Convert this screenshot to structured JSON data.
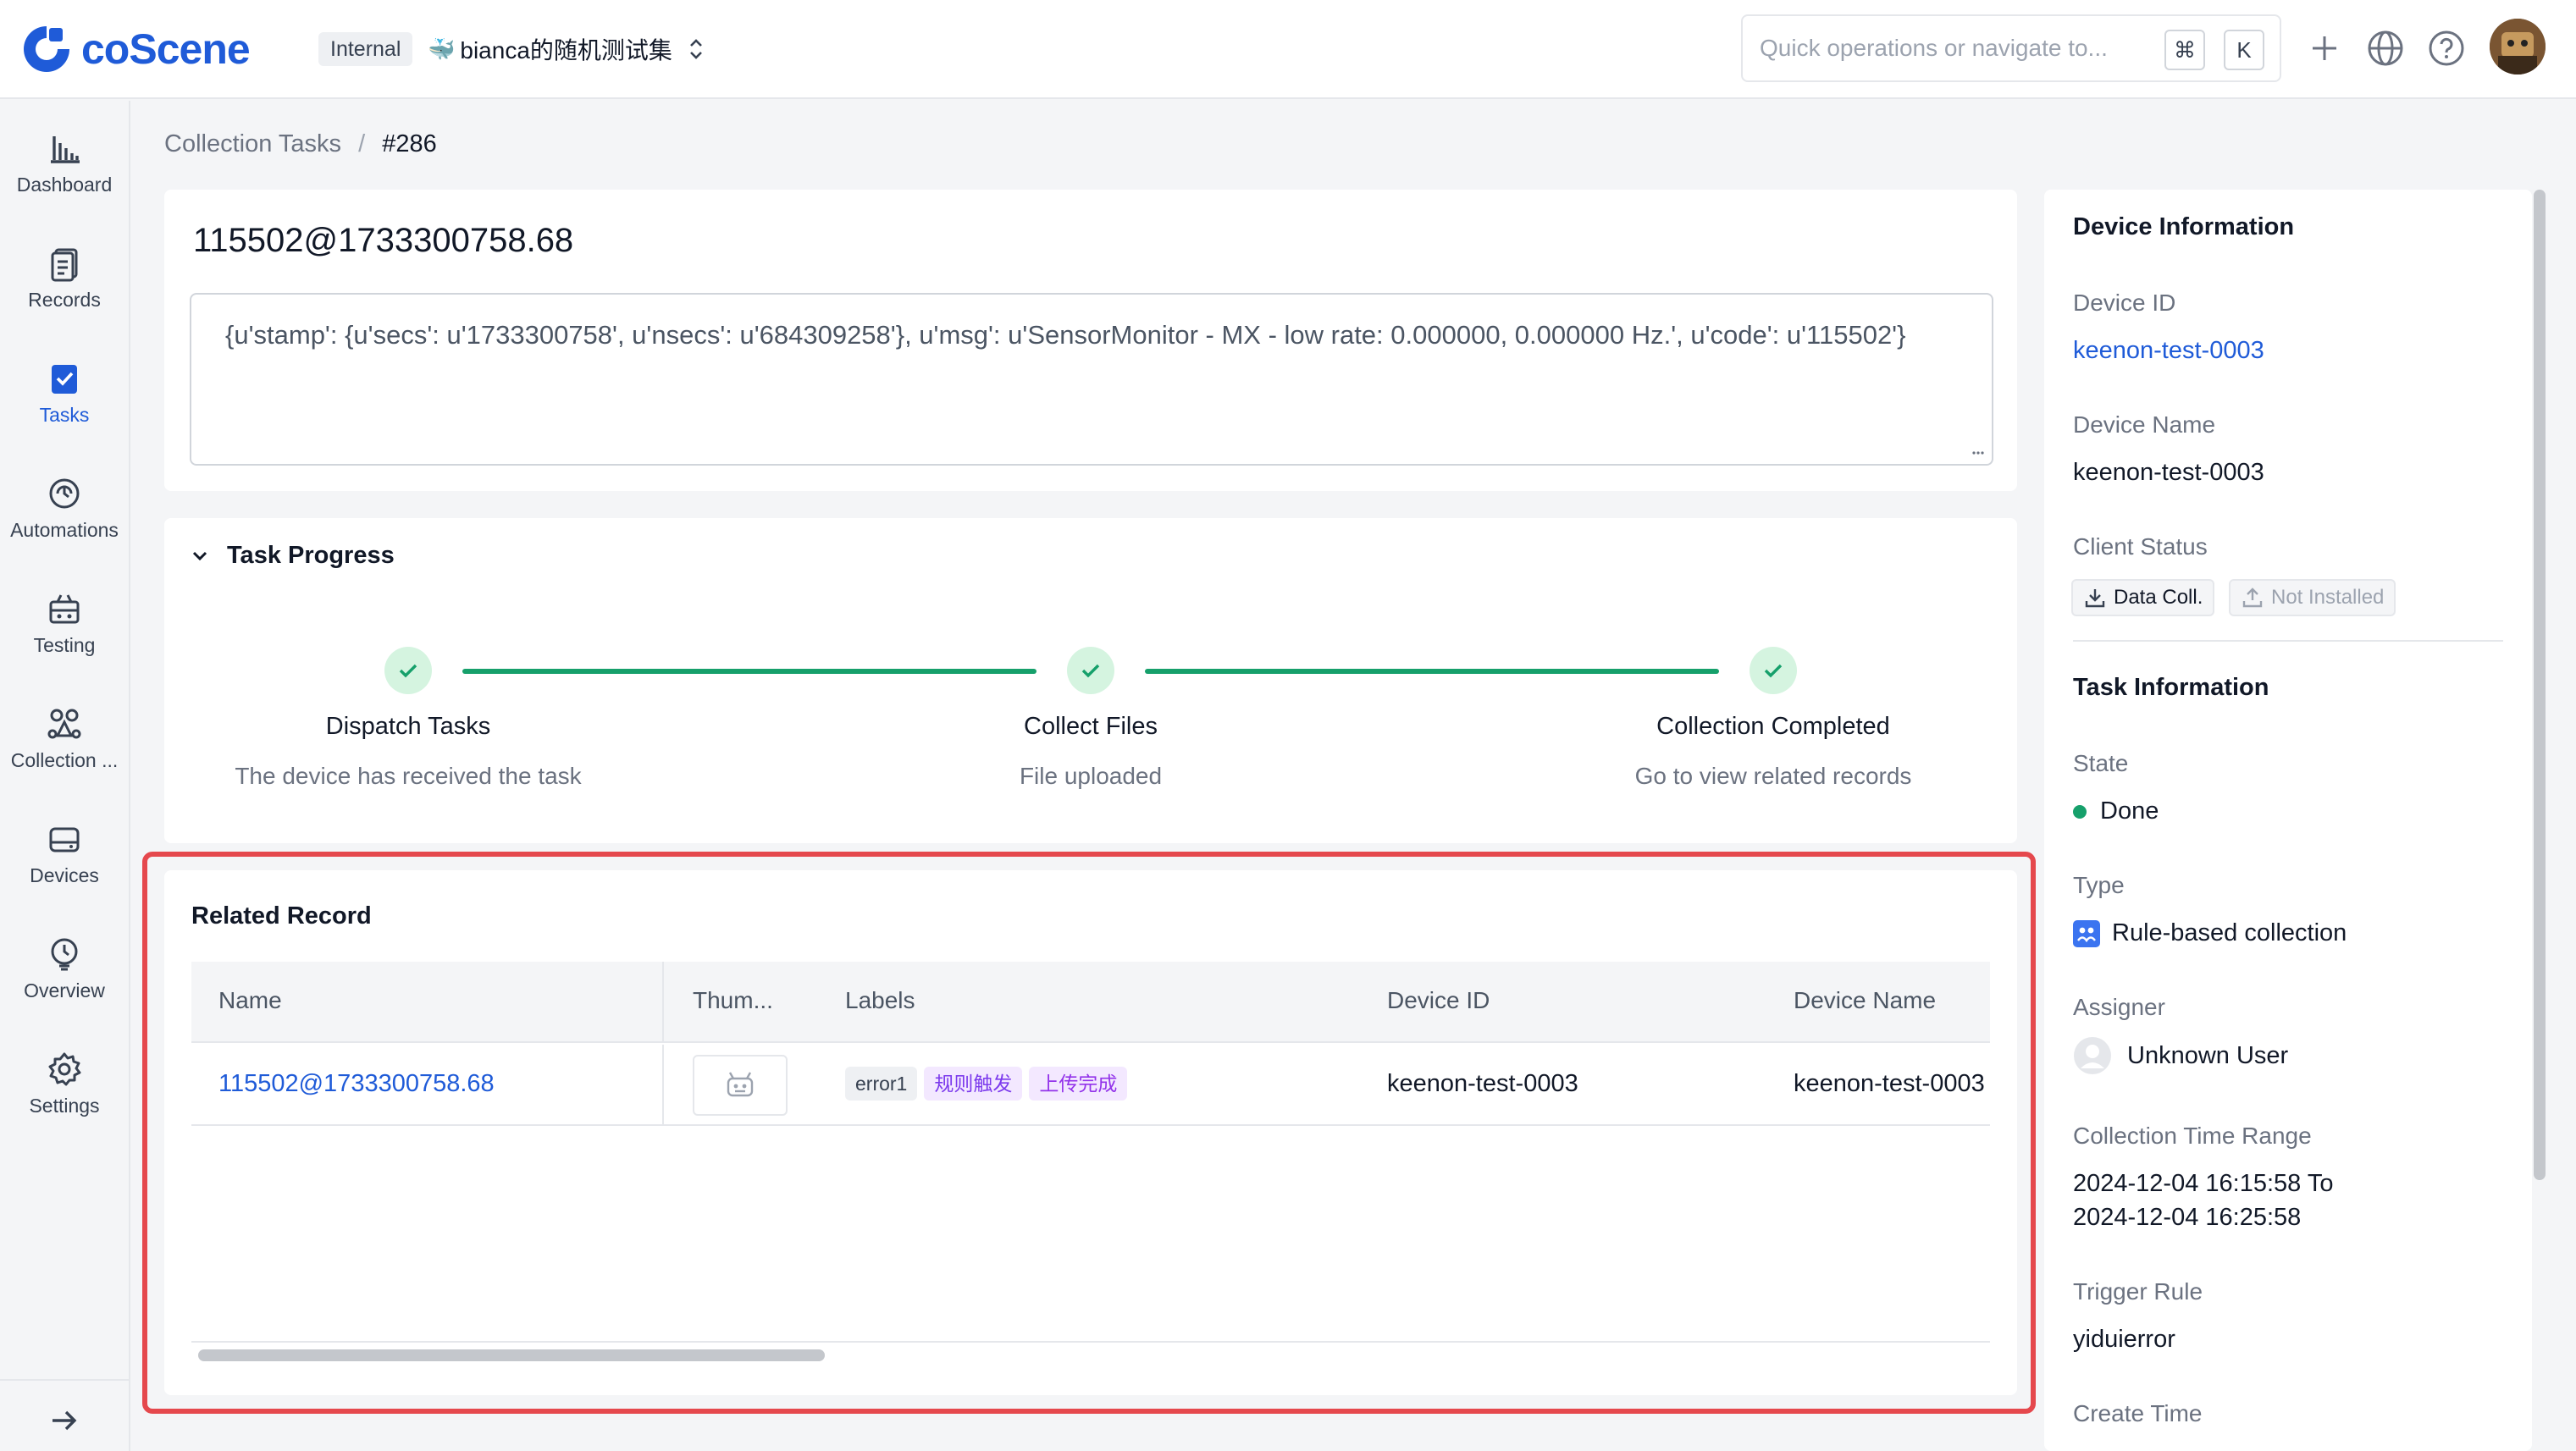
{
  "app": {
    "brand": "coScene",
    "badge": "Internal",
    "project": "bianca的随机测试集",
    "brand_color": "#1f5bd8"
  },
  "search": {
    "placeholder": "Quick operations or navigate to...",
    "key1": "⌘",
    "key2": "K"
  },
  "sidebar": {
    "items": [
      {
        "label": "Dashboard",
        "icon": "chart-icon"
      },
      {
        "label": "Records",
        "icon": "records-icon"
      },
      {
        "label": "Tasks",
        "icon": "tasks-icon",
        "active": true
      },
      {
        "label": "Automations",
        "icon": "automation-icon"
      },
      {
        "label": "Testing",
        "icon": "testing-icon"
      },
      {
        "label": "Collection ...",
        "icon": "collection-icon"
      },
      {
        "label": "Devices",
        "icon": "device-icon"
      },
      {
        "label": "Overview",
        "icon": "overview-icon"
      },
      {
        "label": "Settings",
        "icon": "gear-icon"
      }
    ],
    "collapse": "→"
  },
  "breadcrumb": {
    "parent": "Collection Tasks",
    "sep": "/",
    "current": "#286"
  },
  "task": {
    "title": "115502@1733300758.68",
    "message": "{u'stamp': {u'secs': u'1733300758', u'nsecs': u'684309258'}, u'msg': u'SensorMonitor - MX - low rate: 0.000000, 0.000000 Hz.', u'code': u'115502'}"
  },
  "progress": {
    "heading": "Task Progress",
    "steps": [
      {
        "title": "Dispatch Tasks",
        "desc": "The device has received the task"
      },
      {
        "title": "Collect Files",
        "desc": "File uploaded"
      },
      {
        "title": "Collection Completed",
        "desc": "Go to view related records"
      }
    ],
    "color": "#16a06b"
  },
  "related": {
    "heading": "Related Record",
    "columns": [
      "Name",
      "Thum...",
      "Labels",
      "Device ID",
      "Device Name"
    ],
    "rows": [
      {
        "name": "115502@1733300758.68",
        "labels": [
          "error1",
          "规则触发",
          "上传完成"
        ],
        "device_id": "keenon-test-0003",
        "device_name": "keenon-test-0003"
      }
    ]
  },
  "device_info": {
    "heading": "Device Information",
    "id_label": "Device ID",
    "id_value": "keenon-test-0003",
    "name_label": "Device Name",
    "name_value": "keenon-test-0003",
    "status_label": "Client Status",
    "status_tags": [
      "Data Coll.",
      "Not Installed"
    ]
  },
  "task_info": {
    "heading": "Task Information",
    "state_label": "State",
    "state_value": "Done",
    "state_color": "#16a06b",
    "type_label": "Type",
    "type_value": "Rule-based collection",
    "assigner_label": "Assigner",
    "assigner_value": "Unknown User",
    "range_label": "Collection Time Range",
    "range_value1": "2024-12-04 16:15:58 To",
    "range_value2": "2024-12-04 16:25:58",
    "rule_label": "Trigger Rule",
    "rule_value": "yiduierror",
    "create_label": "Create Time"
  }
}
